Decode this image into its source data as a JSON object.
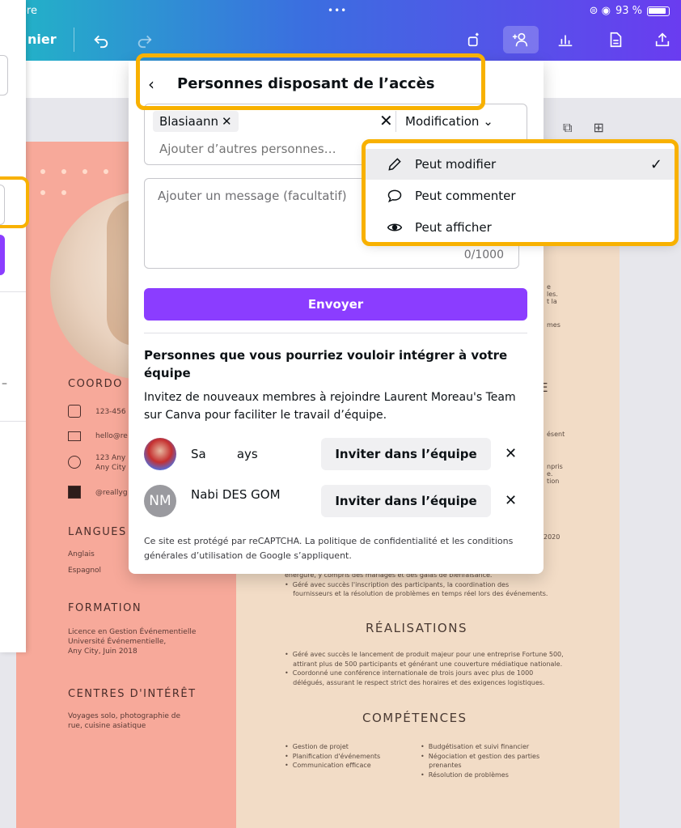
{
  "status": {
    "left": "embre",
    "battery": "93 %"
  },
  "toolbar": {
    "label": "nier"
  },
  "panel": {
    "title": "Personnes disposant de l’accès",
    "chip": "Blasiaann",
    "permission": "Modification",
    "add_placeholder": "Ajouter d’autres personnes…",
    "message_placeholder": "Ajouter un message (facultatif)",
    "counter": "0/1000",
    "send": "Envoyer",
    "suggestions_title": "Personnes que vous pourriez vouloir intégrer à votre équipe",
    "suggestions_desc": "Invitez de nouveaux membres à rejoindre Laurent Moreau's Team sur Canva pour faciliter le travail d’équipe.",
    "people": [
      {
        "name": "Sa        ays",
        "initials": "",
        "invite": "Inviter dans l’équipe"
      },
      {
        "name": "Nabi         DES GOM",
        "initials": "NM",
        "invite": "Inviter dans l’équipe"
      }
    ],
    "captcha": "Ce site est protégé par reCAPTCHA. La politique de confidentialité et les conditions générales d’utilisation de Google s’appliquent."
  },
  "dropdown": {
    "items": [
      {
        "label": "Peut modifier",
        "icon": "pencil-icon",
        "selected": true
      },
      {
        "label": "Peut commenter",
        "icon": "comment-icon",
        "selected": false
      },
      {
        "label": "Peut afficher",
        "icon": "eye-icon",
        "selected": false
      }
    ]
  },
  "resume": {
    "left": {
      "coord_heading": "COORDO",
      "phone": "123-456",
      "email": "hello@re",
      "address": "123 Any\nAny City",
      "social": "@reallyg",
      "lang_heading": "LANGUES",
      "lang1": "Anglais",
      "lang2": "Espagnol",
      "edu_heading": "FORMATION",
      "edu_text": "Licence en Gestion Événementielle\nUniversité Événementielle,\nAny City, Juin 2018",
      "hobby_heading": "CENTRES D'INTÉRÊT",
      "hobby_text": "Voyages solo, photographie de\nrue, cuisine asiatique"
    },
    "right": {
      "snippet1": "e\nles.\nt la",
      "snippet2": "mes",
      "snippet3": "E",
      "snippet4": "ésent",
      "snippet5": "npris\ne.\ntion",
      "year": "2020",
      "exp_text": "énergure, y compris des mariages et des galas de bienfaisance.\n•  Géré avec succès l'inscription des participants, la coordination des\n    fournisseurs et la résolution de problèmes en temps réel lors des événements.",
      "real_heading": "RÉALISATIONS",
      "real_text": "•  Géré avec succès le lancement de produit majeur pour une entreprise Fortune 500,\n    attirant plus de 500 participants et générant une couverture médiatique nationale.\n•  Coordonné une conférence internationale de trois jours avec plus de 1000\n    délégués, assurant le respect strict des horaires et des exigences logistiques.",
      "skills_heading": "COMPÉTENCES",
      "skills_col1": "•  Gestion de projet\n•  Planification d'événements\n•  Communication efficace",
      "skills_col2": "•  Budgétisation et suivi financier\n•  Négociation et gestion des parties\n    prenantes\n•  Résolution de problèmes"
    }
  },
  "colors": {
    "accent": "#8b3dff",
    "highlight": "#f8b100",
    "resume_left": "#f7a99a",
    "resume_right": "#f2dcc6"
  }
}
